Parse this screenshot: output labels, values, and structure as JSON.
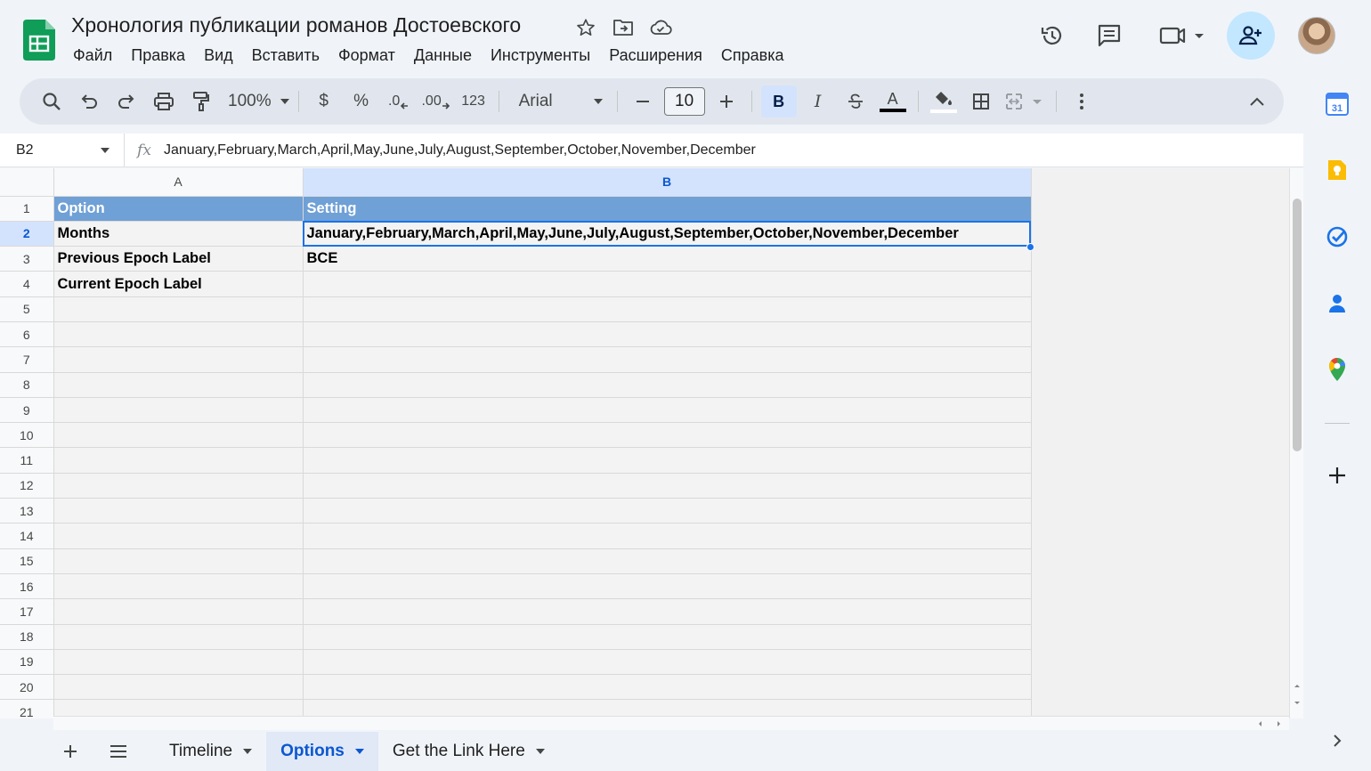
{
  "document": {
    "title": "Хронология публикации романов Достоевского"
  },
  "menu": [
    "Файл",
    "Правка",
    "Вид",
    "Вставить",
    "Формат",
    "Данные",
    "Инструменты",
    "Расширения",
    "Справка"
  ],
  "toolbar": {
    "zoom": "100%",
    "currency": "$",
    "percent": "%",
    "decrease_decimal": ".0",
    "increase_decimal": ".00",
    "number_format": "123",
    "font": "Arial",
    "font_size": "10",
    "bold": "B",
    "italic": "I",
    "text_color_letter": "A"
  },
  "formula_bar": {
    "cell_ref": "B2",
    "fx": "fx",
    "content": "January,February,March,April,May,June,July,August,September,October,November,December"
  },
  "grid": {
    "columns": [
      "A",
      "B"
    ],
    "selected_column": "B",
    "selected_row": "2",
    "row_numbers": [
      "1",
      "2",
      "3",
      "4",
      "5",
      "6",
      "7",
      "8",
      "9",
      "10",
      "11",
      "12",
      "13",
      "14",
      "15",
      "16",
      "17",
      "18",
      "19",
      "20",
      "21"
    ],
    "rows": [
      [
        "Option",
        "Setting"
      ],
      [
        "Months",
        "January,February,March,April,May,June,July,August,September,October,November,December"
      ],
      [
        "Previous Epoch Label",
        "BCE"
      ],
      [
        "Current Epoch Label",
        ""
      ]
    ]
  },
  "sheets": [
    {
      "label": "Timeline",
      "active": false
    },
    {
      "label": "Options",
      "active": true
    },
    {
      "label": "Get the Link Here",
      "active": false
    }
  ],
  "colors": {
    "header_fill": "#6fa0d6",
    "selection": "#1a73e8",
    "app_green": "#0f9d58",
    "share_bg": "#c2e7ff"
  },
  "icons": {
    "star": "star-icon",
    "move": "folder-move-icon",
    "cloud": "cloud-saved-icon",
    "history": "history-icon",
    "comments": "comment-icon",
    "meet": "video-camera-icon",
    "share": "add-person-icon"
  }
}
